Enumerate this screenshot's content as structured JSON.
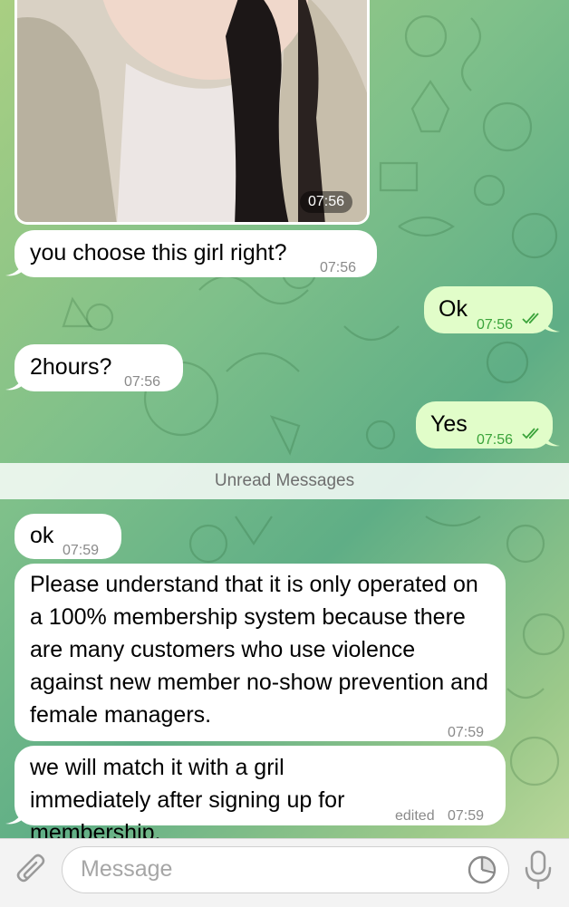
{
  "photo": {
    "time": "07:56"
  },
  "messages": [
    {
      "dir": "in",
      "text": "you choose this girl right?",
      "time": "07:56"
    },
    {
      "dir": "out",
      "text": "Ok",
      "time": "07:56",
      "status": "read"
    },
    {
      "dir": "in",
      "text": "2hours?",
      "time": "07:56"
    },
    {
      "dir": "out",
      "text": "Yes",
      "time": "07:56",
      "status": "read"
    },
    {
      "dir": "in",
      "text": "ok",
      "time": "07:59"
    },
    {
      "dir": "in",
      "text": "Please understand that it is only operated on a 100% membership system because there are many customers who use violence against new member no-show prevention and female managers.",
      "time": "07:59"
    },
    {
      "dir": "in",
      "text": "we will match it with a gril immediately after signing up for membership.",
      "time": "07:59",
      "edited_label": "edited"
    }
  ],
  "divider": {
    "label": "Unread Messages"
  },
  "composer": {
    "placeholder": "Message"
  },
  "icons": {
    "attach": "paperclip-icon",
    "sticker": "sticker-icon",
    "mic": "microphone-icon",
    "read": "double-check-icon"
  },
  "colors": {
    "incoming": "#ffffff",
    "outgoing": "#e1fdc9",
    "check": "#3aa33a"
  }
}
